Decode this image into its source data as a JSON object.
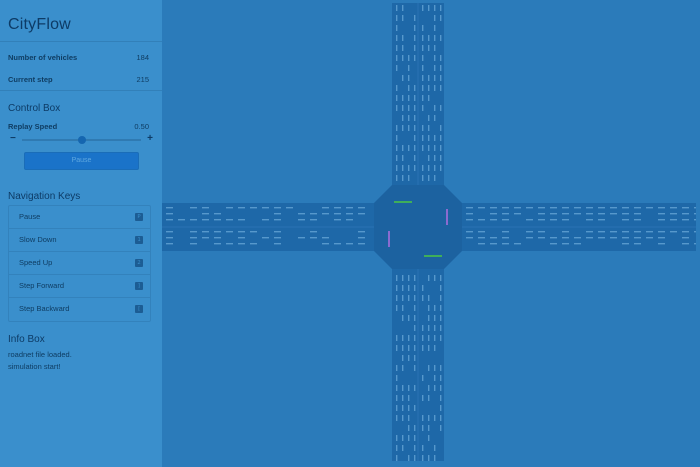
{
  "app": {
    "title": "CityFlow"
  },
  "stats": [
    {
      "label": "Number of vehicles",
      "value": "184"
    },
    {
      "label": "Current step",
      "value": "215"
    }
  ],
  "control_box": {
    "title": "Control Box",
    "replay_speed_label": "Replay Speed",
    "replay_speed_value": "0.50",
    "replay_speed_level": 0.5,
    "minus_label": "−",
    "plus_label": "+",
    "pause_label": "Pause"
  },
  "navigation": {
    "title": "Navigation Keys",
    "items": [
      {
        "label": "Pause",
        "key": "P"
      },
      {
        "label": "Slow Down",
        "key": "1"
      },
      {
        "label": "Speed Up",
        "key": "2"
      },
      {
        "label": "Step Forward",
        "key": "]"
      },
      {
        "label": "Step Backward",
        "key": "["
      }
    ]
  },
  "info_box": {
    "title": "Info Box",
    "lines": [
      "roadnet file loaded.",
      "simulation start!"
    ]
  },
  "colors": {
    "background": "#2b7bba",
    "sidebar": "#3a8fcc",
    "road": "#1e68a8",
    "vehicle": "#6aa8d8",
    "accent": "#1a73c9"
  }
}
